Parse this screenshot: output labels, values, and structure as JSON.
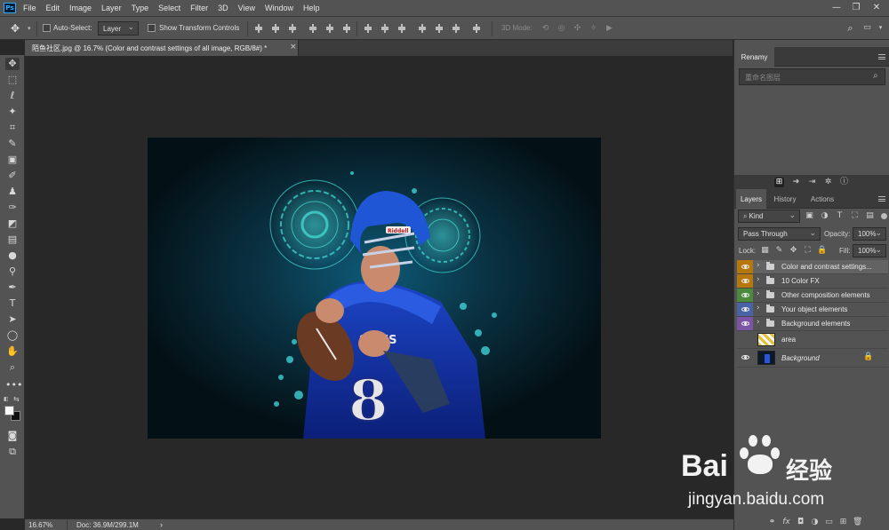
{
  "app": {
    "logo_text": "Ps",
    "menu": [
      "File",
      "Edit",
      "Image",
      "Layer",
      "Type",
      "Select",
      "Filter",
      "3D",
      "View",
      "Window",
      "Help"
    ]
  },
  "options_bar": {
    "auto_select_label": "Auto-Select:",
    "auto_select_target": "Layer",
    "show_transform_label": "Show Transform Controls",
    "mode_3d_label": "3D Mode:"
  },
  "document": {
    "tab_title": "陌鱼社区.jpg @ 16.7% (Color and contrast settings of all image, RGB/8#) *",
    "close_glyph": "×"
  },
  "artwork": {
    "helmet_brand": "Riddell",
    "jersey_text": "SKIES",
    "jersey_number": "8"
  },
  "status_bar": {
    "zoom": "16.67%",
    "doc_size": "Doc: 36.9M/299.1M",
    "arrow": "›"
  },
  "renamy_panel": {
    "title": "Renamy",
    "search_placeholder": "重命名图层"
  },
  "layers_panel": {
    "tabs": [
      "Layers",
      "History",
      "Actions"
    ],
    "filter_label": "Kind",
    "blend_mode": "Pass Through",
    "opacity_label": "Opacity:",
    "opacity_value": "100%",
    "lock_label": "Lock:",
    "fill_label": "Fill:",
    "fill_value": "100%",
    "layers": [
      {
        "name": "Color and contrast settings...",
        "type": "group",
        "color": "#b5770e"
      },
      {
        "name": "10 Color FX",
        "type": "group",
        "color": "#b5770e"
      },
      {
        "name": "Other composition elements",
        "type": "group",
        "color": "#4b8a3b"
      },
      {
        "name": "Your object elements",
        "type": "group",
        "color": "#4a62a6"
      },
      {
        "name": "Background elements",
        "type": "group",
        "color": "#7b54a6"
      },
      {
        "name": "area",
        "type": "layer",
        "hidden": true
      },
      {
        "name": "Background",
        "type": "background",
        "locked": true
      }
    ],
    "bottom_icons": [
      "link-icon",
      "fx-icon",
      "mask-icon",
      "adjustment-icon",
      "group-icon",
      "new-layer-icon",
      "trash-icon"
    ],
    "fx_text": "fx"
  },
  "watermark": {
    "brand": "Bai",
    "brand_cn": "经验",
    "url": "jingyan.baidu.com"
  },
  "colors": {
    "chrome": "#535353",
    "canvas_bg": "#282828",
    "accent_blue": "#31a8ff"
  }
}
